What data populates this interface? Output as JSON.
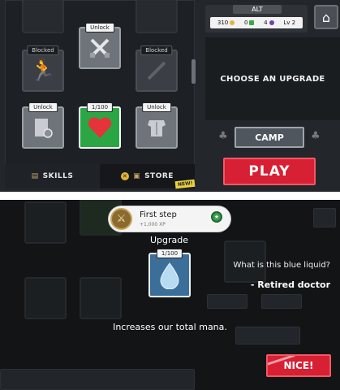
{
  "skills_screen": {
    "tiles": [
      {
        "tag": "Unlock",
        "icon": "crossed-swords-icon"
      },
      {
        "tag": "Blocked",
        "icon": "runner-icon"
      },
      {
        "tag": "Blocked",
        "icon": "sword-icon"
      },
      {
        "tag": "Unlock",
        "icon": "shield-icon"
      },
      {
        "tag": "1/100",
        "icon": "heart-icon"
      },
      {
        "tag": "Unlock",
        "icon": "armor-icon"
      }
    ],
    "tabs": {
      "skills": "SKILLS",
      "store": "STORE"
    },
    "new_badge": "NEW!"
  },
  "header": {
    "alt_label": "ALT",
    "stats": {
      "gold": "310",
      "gems": "0",
      "potions": "4",
      "level": "Lv 2"
    }
  },
  "upgrade_panel": {
    "title": "CHOOSE AN UPGRADE"
  },
  "buttons": {
    "camp": "CAMP",
    "play": "PLAY"
  },
  "overlay": {
    "achievement": {
      "title": "First step",
      "xp": "+1,000 XP"
    },
    "upgrade_title": "Upgrade",
    "card_tag": "1/100",
    "quote": "What is this blue liquid?",
    "quote_author": "- Retired doctor",
    "description": "Increases our total mana.",
    "nice_button": "NICE!"
  },
  "colors": {
    "play_red": "#d72033",
    "health_green": "#2aa645",
    "mana_blue": "#3b6f9a"
  }
}
